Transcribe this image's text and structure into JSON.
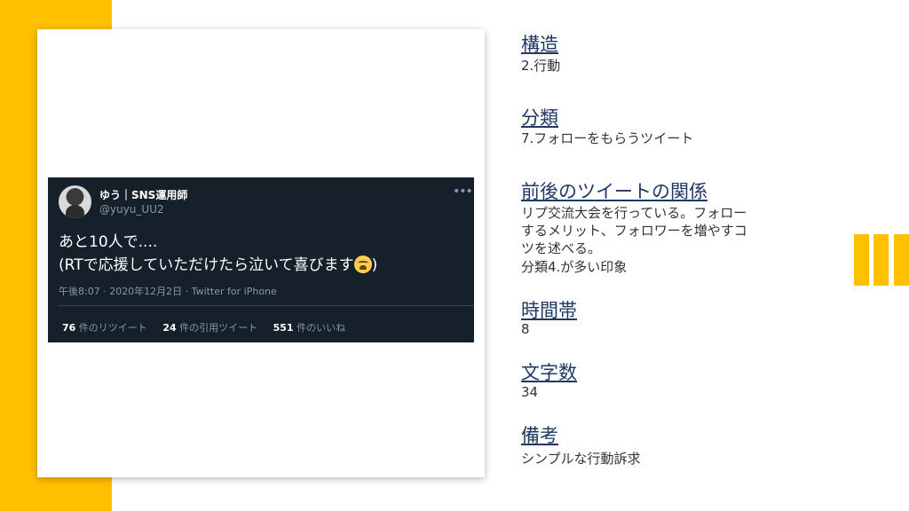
{
  "tweet": {
    "user_name": "ゆう｜SNS運用師",
    "user_handle": "@yuyu_UU2",
    "text_line1": "あと10人で....",
    "text_line2_before": "(RTで応援していただけたら泣いて喜びます",
    "text_line2_after": ")",
    "meta": "午後8:07 · 2020年12月2日 · Twitter for iPhone",
    "retweets_num": "76",
    "retweets_label": "件のリツイート",
    "quotes_num": "24",
    "quotes_label": "件の引用ツイート",
    "likes_num": "551",
    "likes_label": "件のいいね"
  },
  "info": {
    "structure_heading": "構造",
    "structure_value": "2.行動",
    "category_heading": "分類",
    "category_value": "7.フォローをもらうツイート",
    "relation_heading": "前後のツイートの関係",
    "relation_line1": "リプ交流大会を行っている。フォロー",
    "relation_line2": "するメリット、フォロワーを増やすコ",
    "relation_line3": "ツを述べる。",
    "relation_line4": "分類4.が多い印象",
    "time_heading": "時間帯",
    "time_value": "8",
    "chars_heading": "文字数",
    "chars_value": "34",
    "notes_heading": "備考",
    "notes_value": "シンプルな行動訴求"
  },
  "colors": {
    "accent": "#FFC000",
    "heading": "#1F3864",
    "tweet_bg": "#15202B"
  }
}
